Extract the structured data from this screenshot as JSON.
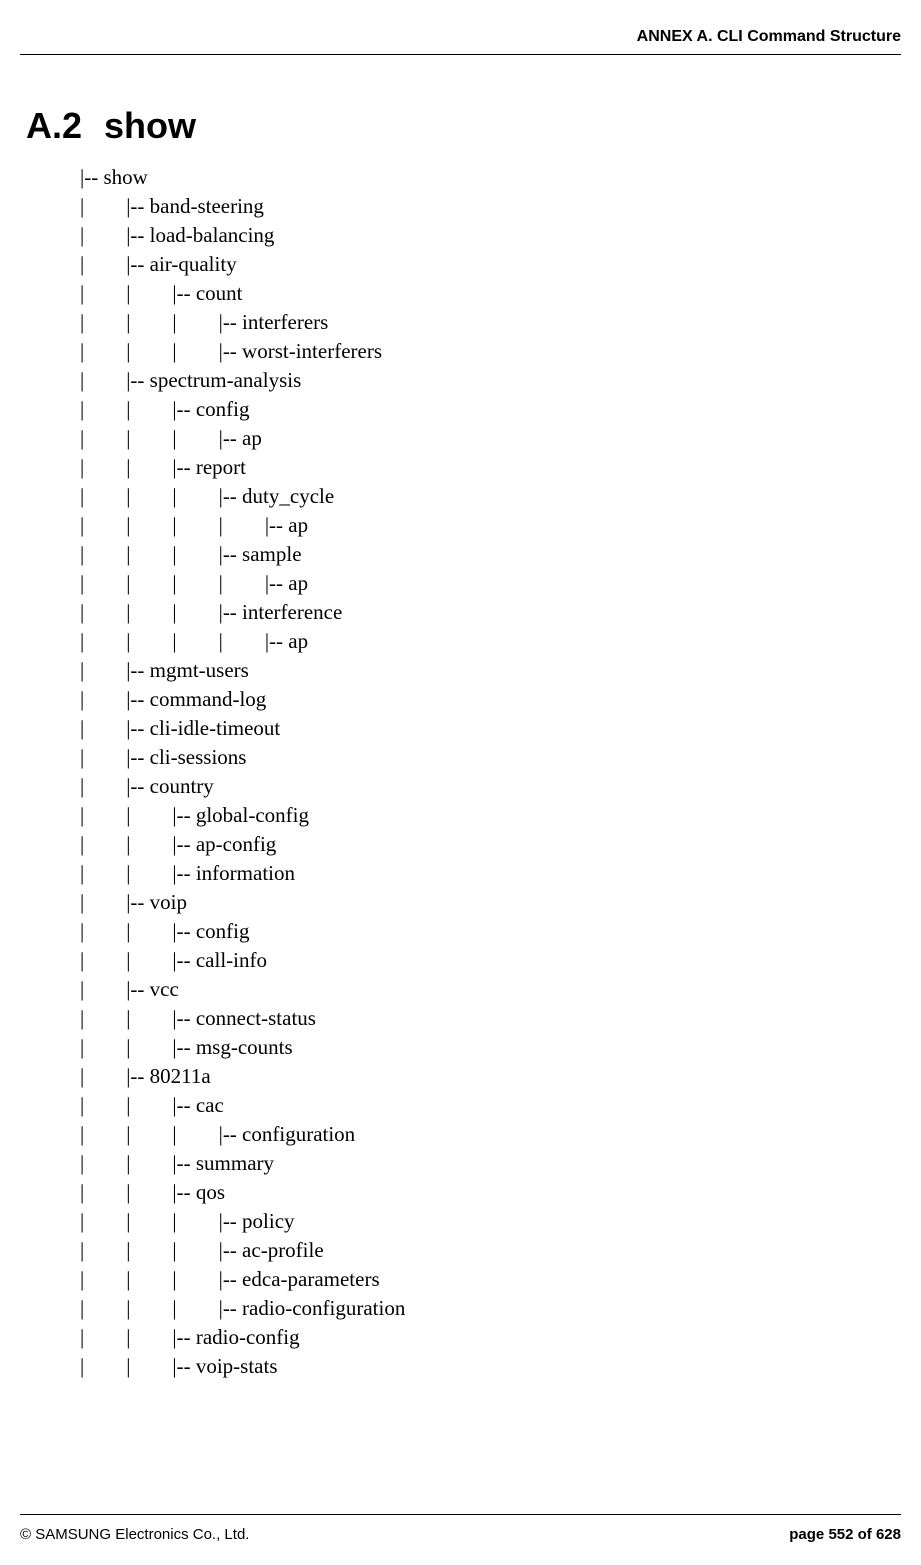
{
  "header": {
    "right": "ANNEX A. CLI Command Structure"
  },
  "heading": {
    "number": "A.2",
    "title": "show"
  },
  "tree_lines": [
    "|-- show",
    "|        |-- band-steering",
    "|        |-- load-balancing",
    "|        |-- air-quality",
    "|        |        |-- count",
    "|        |        |        |-- interferers",
    "|        |        |        |-- worst-interferers",
    "|        |-- spectrum-analysis",
    "|        |        |-- config",
    "|        |        |        |-- ap",
    "|        |        |-- report",
    "|        |        |        |-- duty_cycle",
    "|        |        |        |        |-- ap",
    "|        |        |        |-- sample",
    "|        |        |        |        |-- ap",
    "|        |        |        |-- interference",
    "|        |        |        |        |-- ap",
    "|        |-- mgmt-users",
    "|        |-- command-log",
    "|        |-- cli-idle-timeout",
    "|        |-- cli-sessions",
    "|        |-- country",
    "|        |        |-- global-config",
    "|        |        |-- ap-config",
    "|        |        |-- information",
    "|        |-- voip",
    "|        |        |-- config",
    "|        |        |-- call-info",
    "|        |-- vcc",
    "|        |        |-- connect-status",
    "|        |        |-- msg-counts",
    "|        |-- 80211a",
    "|        |        |-- cac",
    "|        |        |        |-- configuration",
    "|        |        |-- summary",
    "|        |        |-- qos",
    "|        |        |        |-- policy",
    "|        |        |        |-- ac-profile",
    "|        |        |        |-- edca-parameters",
    "|        |        |        |-- radio-configuration",
    "|        |        |-- radio-config",
    "|        |        |-- voip-stats"
  ],
  "footer": {
    "left": "© SAMSUNG Electronics Co., Ltd.",
    "right": "page 552 of 628"
  }
}
